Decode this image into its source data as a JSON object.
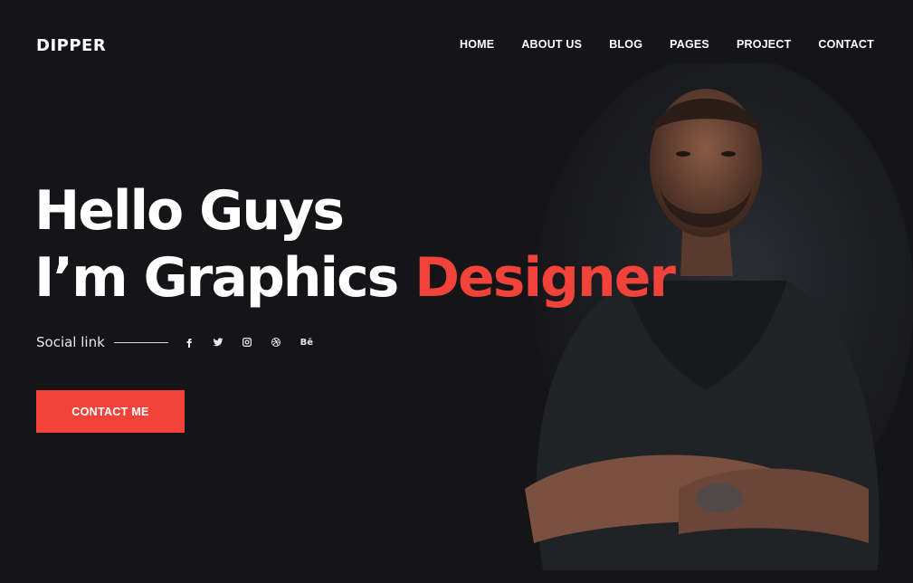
{
  "brand": {
    "logo": "DIPPER"
  },
  "nav": {
    "items": [
      {
        "label": "HOME"
      },
      {
        "label": "ABOUT US"
      },
      {
        "label": "BLOG"
      },
      {
        "label": "PAGES"
      },
      {
        "label": "PROJECT"
      },
      {
        "label": "CONTACT"
      }
    ]
  },
  "hero": {
    "line1": "Hello Guys",
    "line2_prefix": "I’m Graphics ",
    "line2_accent": "Designer",
    "social_label": "Social link",
    "social_icons": [
      "facebook-icon",
      "twitter-icon",
      "instagram-icon",
      "dribbble-icon",
      "behance-icon"
    ],
    "behance_text": "Bē",
    "cta_label": "CONTACT ME"
  },
  "colors": {
    "background": "#151517",
    "accent": "#f1433a",
    "text": "#ffffff"
  }
}
